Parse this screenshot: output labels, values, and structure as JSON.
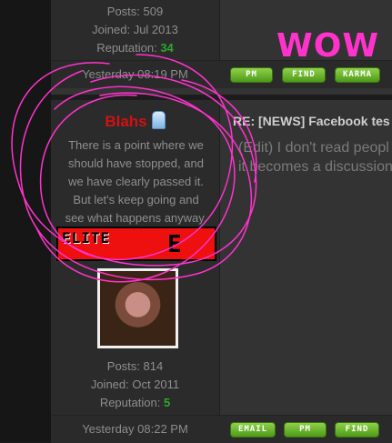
{
  "post_top": {
    "posts": "Posts: 509",
    "joined": "Joined: Jul 2013",
    "reputation_label": "Reputation:",
    "reputation_value": "34",
    "timestamp": "Yesterday 08:19 PM",
    "buttons": [
      "PM",
      "FIND",
      "KARMA"
    ]
  },
  "post_main": {
    "username": "Blahs",
    "signature": [
      "There is a point where we",
      "should have stopped, and",
      "we have clearly passed it.",
      "But let's keep going and",
      "see what happens anyway."
    ],
    "rank_text": "ELITE",
    "rank_letter": "E",
    "posts": "Posts: 814",
    "joined": "Joined: Oct 2011",
    "reputation_label": "Reputation:",
    "reputation_value": "5",
    "timestamp": "Yesterday 08:22 PM",
    "buttons": [
      "EMAIL",
      "PM",
      "FIND"
    ],
    "title": "RE: [NEWS] Facebook tes",
    "body": [
      "(Edit) I don't read peopl",
      "it becomes a discussion"
    ]
  },
  "annotation": {
    "wow": "WOW",
    "scribble_color": "#ff33cc"
  },
  "colors": {
    "username": "#d51010",
    "reputation": "#2fa52f",
    "button_green": "#6db530"
  }
}
